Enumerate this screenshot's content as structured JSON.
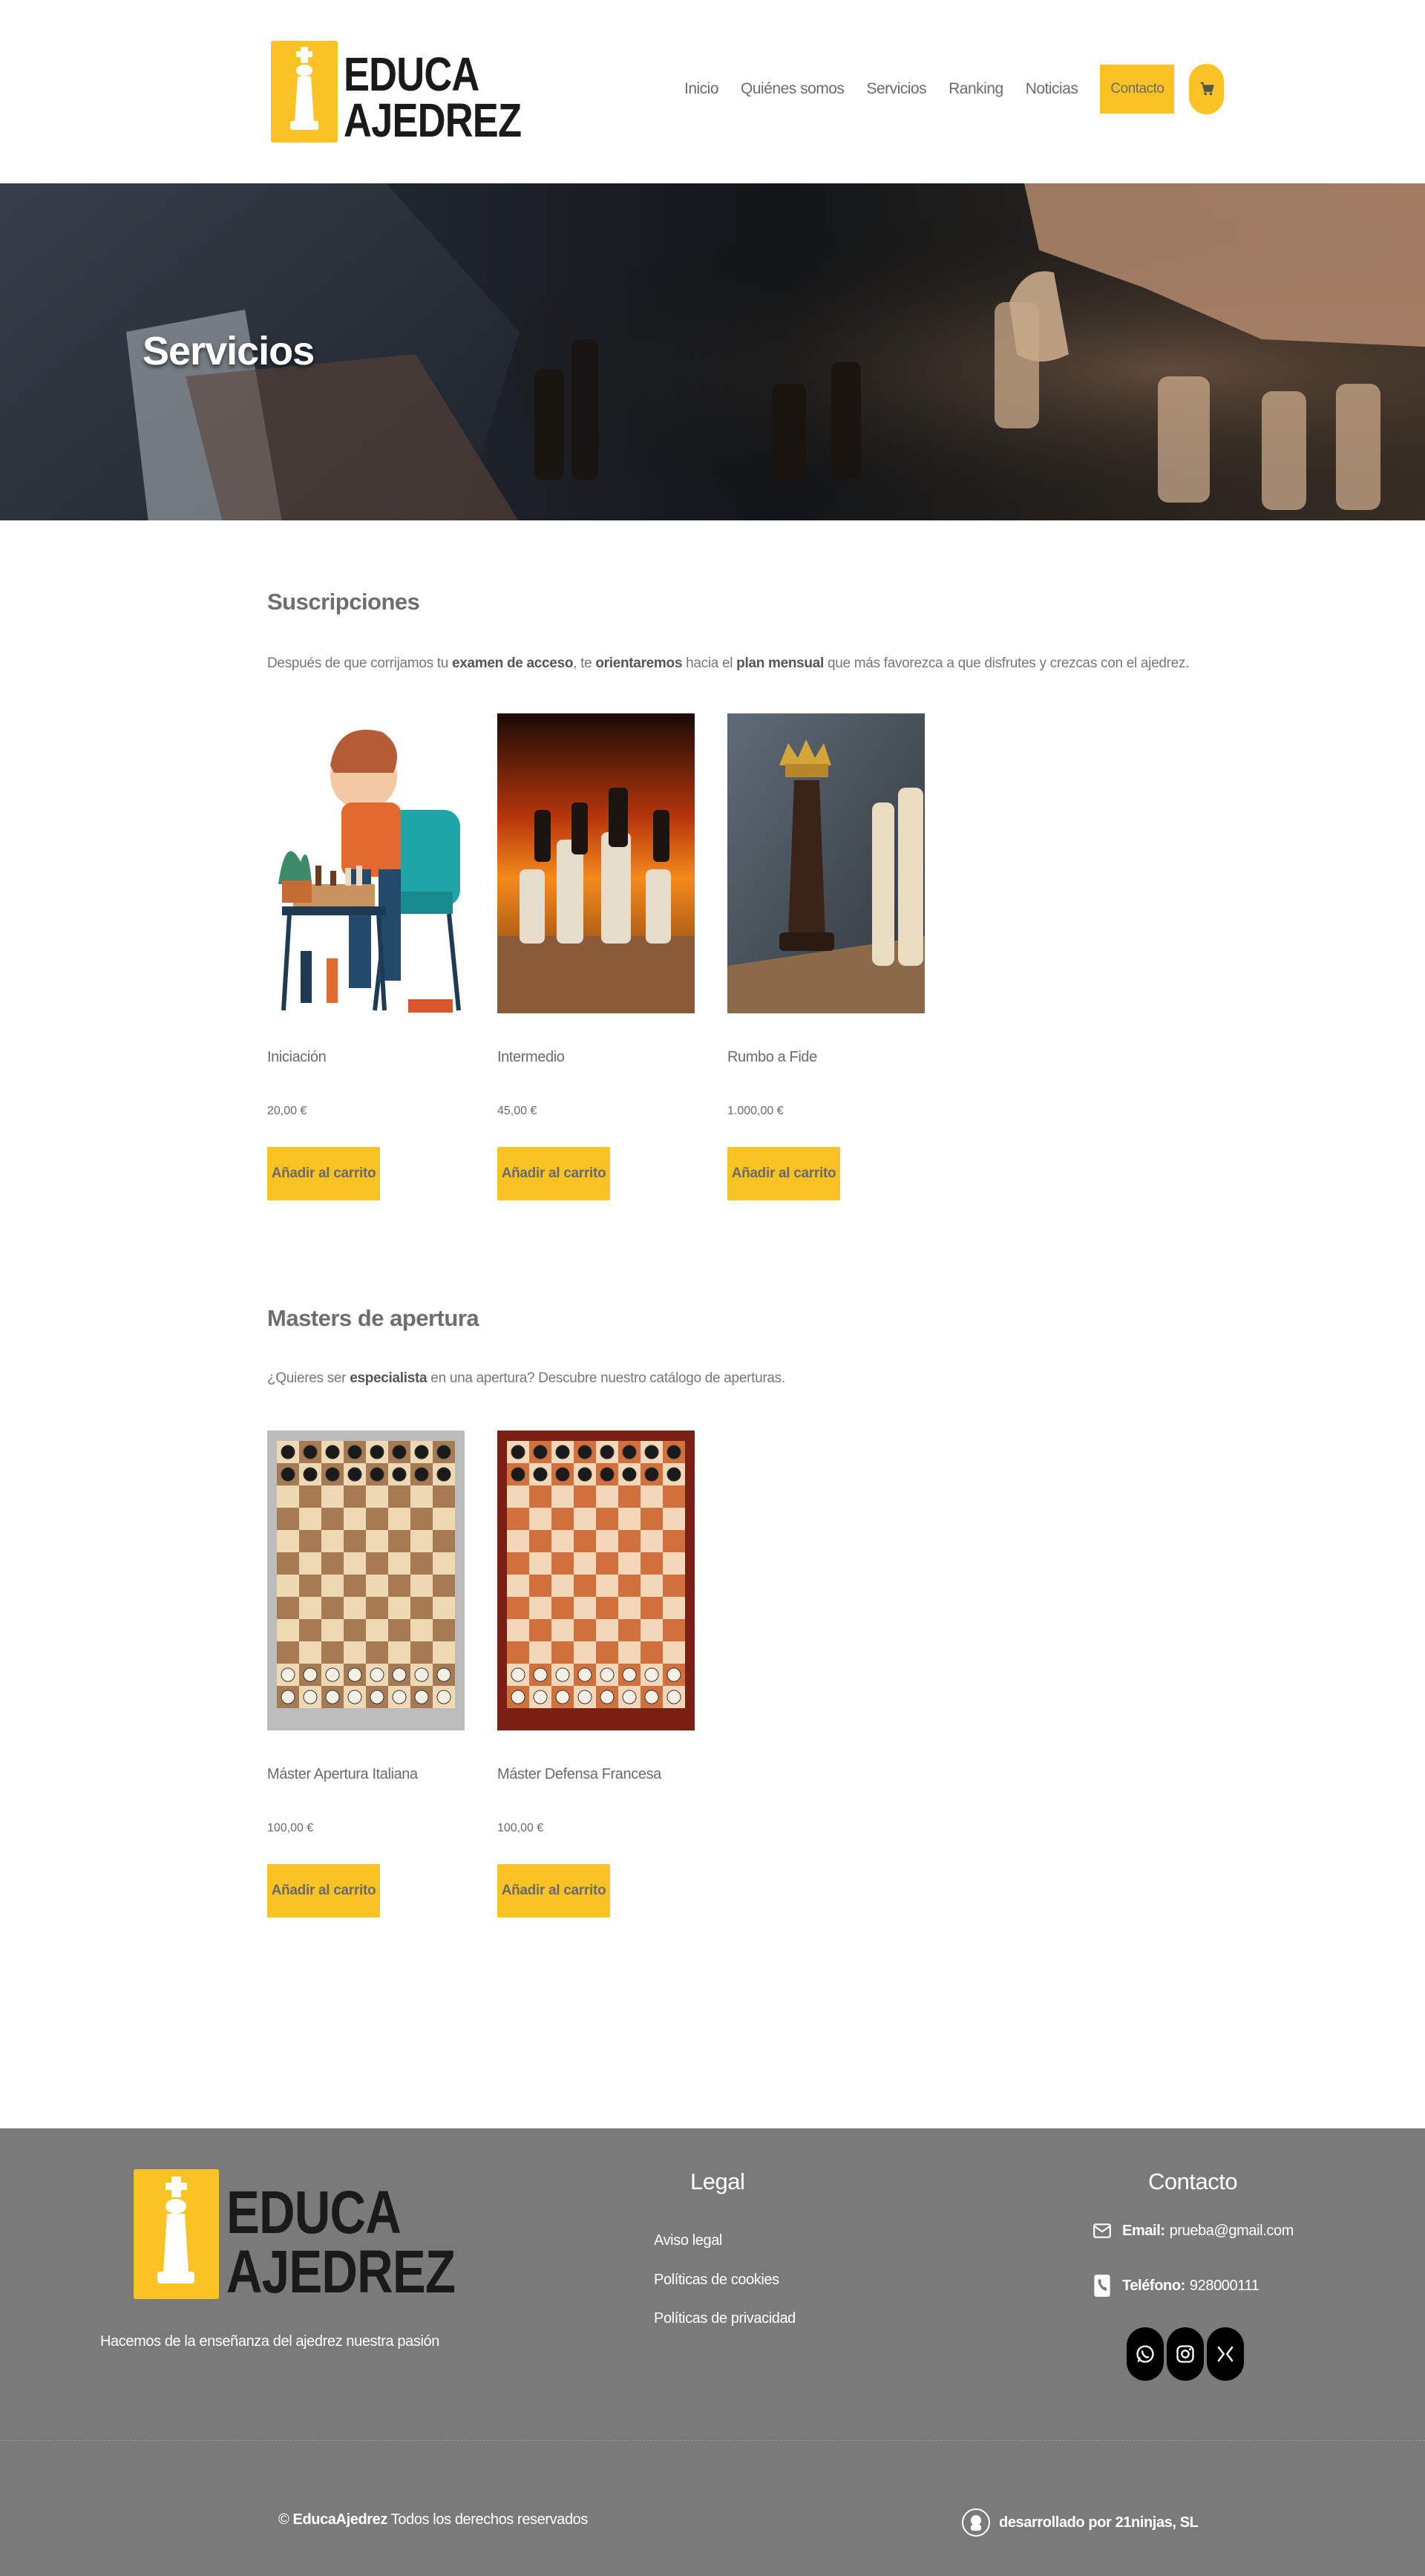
{
  "brand": {
    "line1": "EDUCA",
    "line2": "AJEDREZ"
  },
  "nav": {
    "items": [
      "Inicio",
      "Quiénes somos",
      "Servicios",
      "Ranking",
      "Noticias"
    ],
    "contact": "Contacto"
  },
  "hero": {
    "title": "Servicios"
  },
  "subscriptions": {
    "title": "Suscripciones",
    "desc": {
      "p1": "Después de que corrijamos tu ",
      "b1": "examen de acceso",
      "p2": ", te ",
      "b2": "orientaremos",
      "p3": " hacia el ",
      "b3": "plan mensual",
      "p4": " que más favorezca a que disfrutes y crezcas con el ajedrez."
    },
    "products": [
      {
        "name": "Iniciación",
        "price": "20,00 €",
        "button": "Añadir al carrito"
      },
      {
        "name": "Intermedio",
        "price": "45,00 €",
        "button": "Añadir al carrito"
      },
      {
        "name": "Rumbo a Fide",
        "price": "1.000,00 €",
        "button": "Añadir al carrito"
      }
    ]
  },
  "masters": {
    "title": "Masters de apertura",
    "desc": {
      "p1": "¿Quieres ser ",
      "b1": "especialista",
      "p2": " en una apertura? Descubre nuestro catálogo de aperturas."
    },
    "products": [
      {
        "name": "Máster Apertura Italiana",
        "price": "100,00 €",
        "button": "Añadir al carrito"
      },
      {
        "name": "Máster Defensa Francesa",
        "price": "100,00 €",
        "button": "Añadir al carrito"
      }
    ]
  },
  "footer": {
    "tagline": "Hacemos de la enseñanza del ajedrez nuestra pasión",
    "legal": {
      "title": "Legal",
      "links": [
        "Aviso legal",
        "Políticas de cookies",
        "Políticas de privacidad"
      ]
    },
    "contact": {
      "title": "Contacto",
      "email_label": "Email:",
      "email": "prueba@gmail.com",
      "phone_label": "Teléfono:",
      "phone": "928000111"
    },
    "copyright": {
      "symbol": "©",
      "brand": "EducaAjedrez",
      "text": "Todos los derechos reservados"
    },
    "developed": "desarrollado por 21ninjas, SL"
  },
  "colors": {
    "accent": "#f9c423",
    "footer_bg": "#7a7a7a"
  },
  "icons": [
    "cart-icon",
    "email-icon",
    "phone-icon",
    "whatsapp-icon",
    "instagram-icon",
    "x-icon",
    "ninja-icon"
  ]
}
